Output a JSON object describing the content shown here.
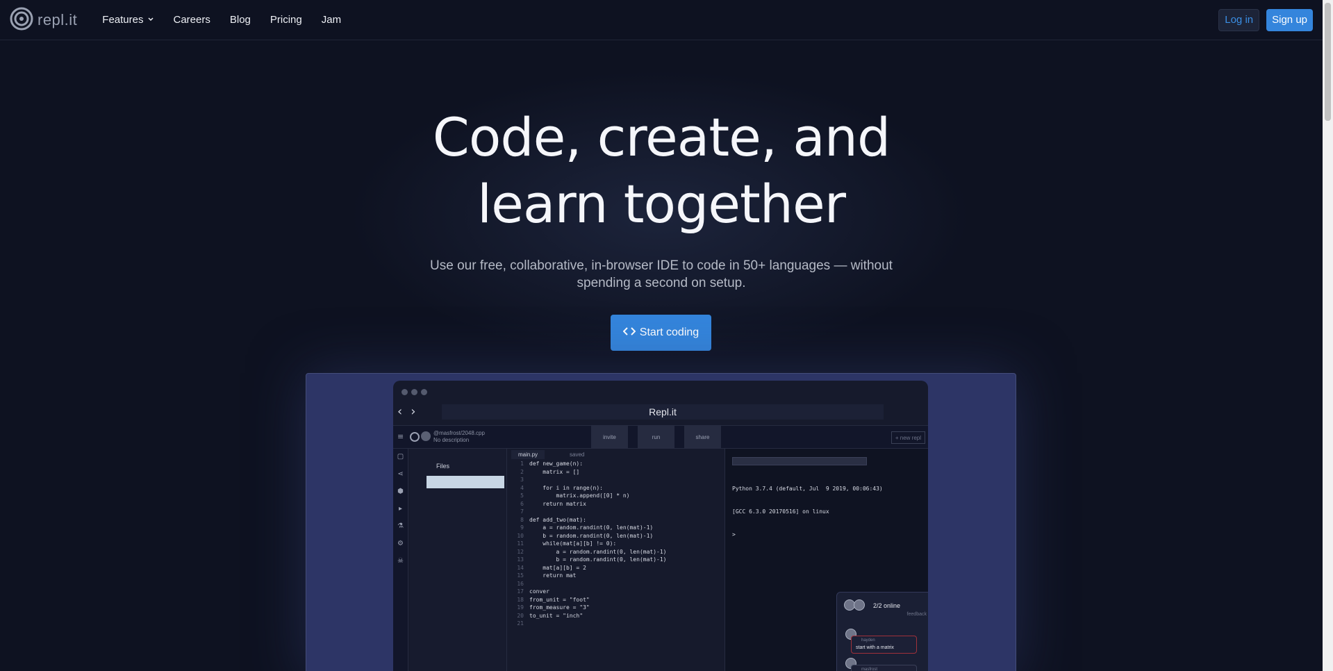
{
  "nav": {
    "logo_text": "repl.it",
    "links": [
      "Features",
      "Careers",
      "Blog",
      "Pricing",
      "Jam"
    ],
    "login_label": "Log in",
    "signup_label": "Sign up"
  },
  "hero": {
    "title_line1": "Code, create, and",
    "title_line2": "learn together",
    "subtitle": "Use our free, collaborative, in-browser IDE to code in 50+ languages — without spending a second on setup.",
    "cta_label": "Start coding"
  },
  "ide": {
    "window_title": "Repl.it",
    "user_repl": "@masfrost/2048.cpp",
    "repl_desc": "No description",
    "invite_label": "invite",
    "run_label": "run",
    "share_label": "share",
    "new_repl_label": "+ new repl",
    "files_label": "Files",
    "file_tab": "main.py",
    "saved_label": "saved",
    "code_lines": [
      "def new_game(n):",
      "    matrix = []",
      "",
      "    for i in range(n):",
      "        matrix.append([0] * n)",
      "    return matrix",
      "",
      "def add_two(mat):",
      "    a = random.randint(0, len(mat)-1)",
      "    b = random.randint(0, len(mat)-1)",
      "    while(mat[a][b] != 0):",
      "        a = random.randint(0, len(mat)-1)",
      "        b = random.randint(0, len(mat)-1)",
      "    mat[a][b] = 2",
      "    return mat",
      "",
      "conver",
      "from_unit = \"foot\"",
      "from_measure = \"3\"",
      "to_unit = \"inch\"",
      ""
    ],
    "console_line1": "Python 3.7.4 (default, Jul  9 2019, 00:06:43)",
    "console_line2": "[GCC 6.3.0 20170516] on linux",
    "console_prompt": "> ",
    "online_label": "2/2 online",
    "feedback_label": "feedback",
    "chat_user": "hayden",
    "chat_message": "start with a matrix",
    "chat_user2": "masfrost"
  }
}
